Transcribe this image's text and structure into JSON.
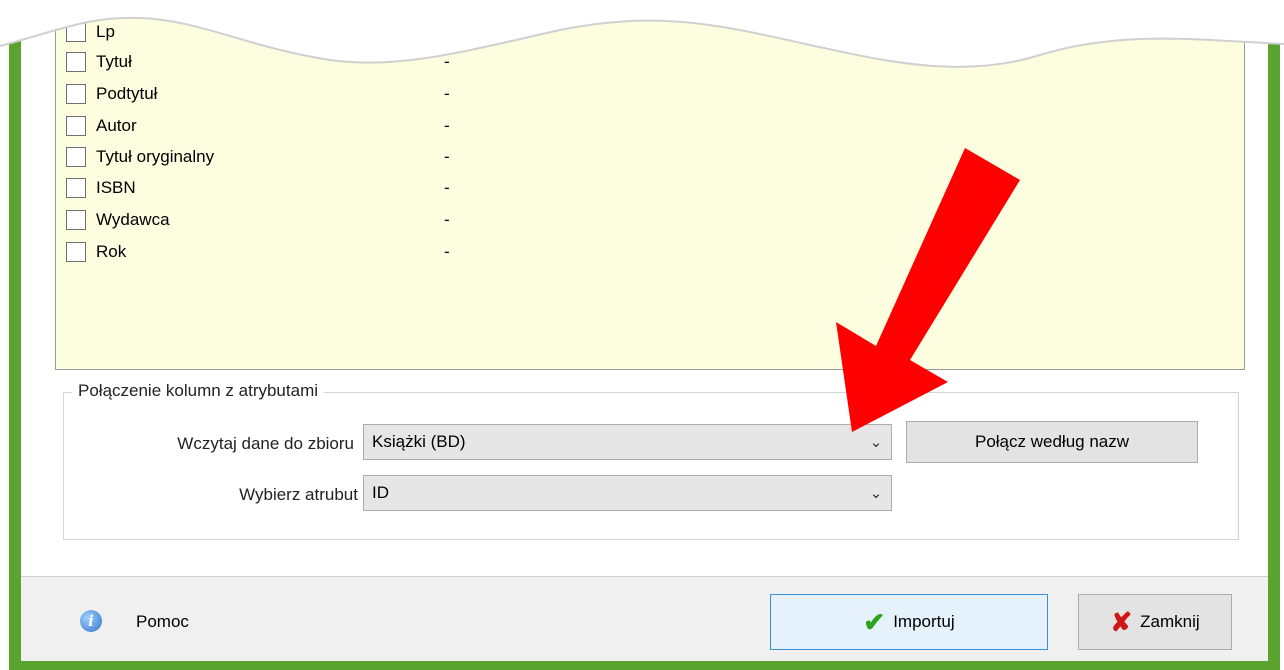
{
  "list": {
    "rows": [
      {
        "label": "Lp",
        "value": ""
      },
      {
        "label": "Tytuł",
        "value": "-"
      },
      {
        "label": "Podtytuł",
        "value": "-"
      },
      {
        "label": "Autor",
        "value": "-"
      },
      {
        "label": "Tytuł oryginalny",
        "value": "-"
      },
      {
        "label": "ISBN",
        "value": "-"
      },
      {
        "label": "Wydawca",
        "value": "-"
      },
      {
        "label": "Rok",
        "value": "-"
      }
    ]
  },
  "mapping": {
    "title": "Połączenie kolumn z atrybutami",
    "dataset_label": "Wczytaj dane do zbioru",
    "dataset_value": "Książki (BD)",
    "attribute_label": "Wybierz atrubut",
    "attribute_value": "ID",
    "match_button": "Połącz według nazw"
  },
  "footer": {
    "help_label": "Pomoc",
    "import_button": "Importuj",
    "close_button": "Zamknij"
  },
  "colors": {
    "frame_green": "#5aa32f",
    "list_background": "#fdfde0",
    "arrow_red": "#ff0000"
  },
  "icons": {
    "help": "info-circle-icon",
    "import": "checkmark-icon",
    "close": "x-icon",
    "dropdown": "chevron-down-icon"
  }
}
